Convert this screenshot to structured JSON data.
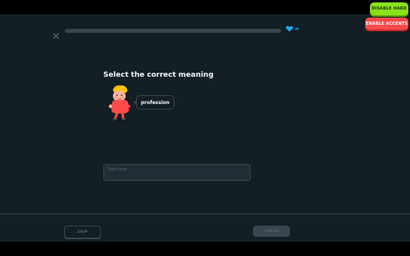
{
  "header": {
    "close_icon": "close-icon",
    "progress_fraction": 0,
    "hearts_icon": "heart-gem-icon",
    "hearts_value": "∞"
  },
  "toggles": {
    "disable_hard_label": "DISABLE HARD",
    "enable_accents_label": "ENABLE ACCENTS"
  },
  "challenge": {
    "title": "Select the correct meaning",
    "word": "profession"
  },
  "answer": {
    "placeholder": "Type here...",
    "value": ""
  },
  "footer": {
    "skip_label": "SKIP",
    "check_label": "CHECK"
  },
  "colors": {
    "background": "#131f24",
    "accent_green": "#89e219",
    "accent_red": "#ff4b4b",
    "heart_blue": "#1cb0f6"
  }
}
